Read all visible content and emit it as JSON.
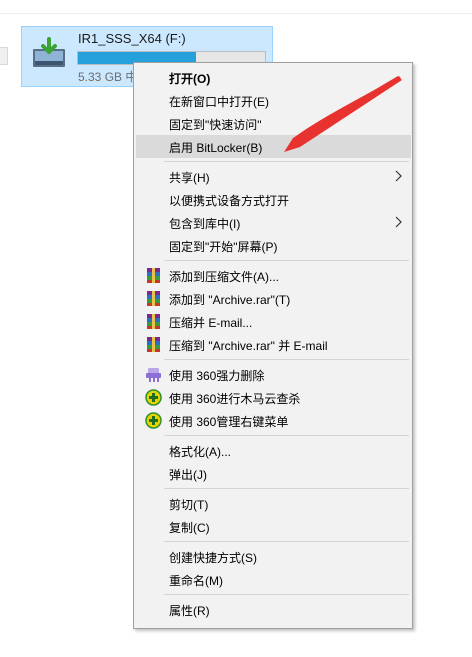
{
  "drive": {
    "name": "IR1_SSS_X64 (F:)",
    "size_text": "5.33 GB 中",
    "usage_fraction": 0.63
  },
  "menu": {
    "groups": [
      [
        {
          "label": "打开(O)",
          "bold": true
        },
        {
          "label": "在新窗口中打开(E)"
        },
        {
          "label": "固定到\"快速访问\""
        },
        {
          "label": "启用 BitLocker(B)",
          "hover": true
        }
      ],
      [
        {
          "label": "共享(H)",
          "submenu": true
        },
        {
          "label": "以便携式设备方式打开"
        },
        {
          "label": "包含到库中(I)",
          "submenu": true
        },
        {
          "label": "固定到\"开始\"屏幕(P)"
        }
      ],
      [
        {
          "label": "添加到压缩文件(A)...",
          "icon": "winrar-icon"
        },
        {
          "label": "添加到 \"Archive.rar\"(T)",
          "icon": "winrar-icon"
        },
        {
          "label": "压缩并 E-mail...",
          "icon": "winrar-icon"
        },
        {
          "label": "压缩到 \"Archive.rar\" 并 E-mail",
          "icon": "winrar-icon"
        }
      ],
      [
        {
          "label": "使用 360强力删除",
          "icon": "shredder-icon"
        },
        {
          "label": "使用 360进行木马云查杀",
          "icon": "360-plus-icon"
        },
        {
          "label": "使用 360管理右键菜单",
          "icon": "360-plus-icon"
        }
      ],
      [
        {
          "label": "格式化(A)..."
        },
        {
          "label": "弹出(J)"
        }
      ],
      [
        {
          "label": "剪切(T)"
        },
        {
          "label": "复制(C)"
        }
      ],
      [
        {
          "label": "创建快捷方式(S)"
        },
        {
          "label": "重命名(M)"
        }
      ],
      [
        {
          "label": "属性(R)"
        }
      ]
    ]
  },
  "colors": {
    "selection": "#cce8ff",
    "usage_bar": "#26a0da",
    "arrow": "#e8322f"
  }
}
